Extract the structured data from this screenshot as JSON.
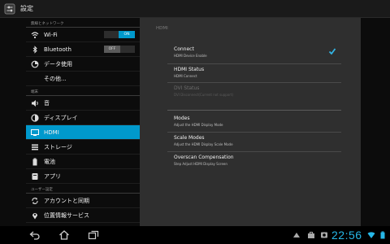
{
  "app": {
    "title": "設定",
    "icon": "settings-icon"
  },
  "sidebar": {
    "sections": [
      {
        "header": "無線とネットワーク",
        "items": [
          {
            "label": "Wi-Fi",
            "icon": "wifi-icon",
            "toggle": "ON"
          },
          {
            "label": "Bluetooth",
            "icon": "bluetooth-icon",
            "toggle": "OFF"
          },
          {
            "label": "データ使用",
            "icon": "data-usage-icon"
          },
          {
            "label": "その他..."
          }
        ]
      },
      {
        "header": "端末",
        "items": [
          {
            "label": "音",
            "icon": "sound-icon"
          },
          {
            "label": "ディスプレイ",
            "icon": "display-icon"
          },
          {
            "label": "HDMI",
            "icon": "hdmi-icon",
            "selected": true
          },
          {
            "label": "ストレージ",
            "icon": "storage-icon"
          },
          {
            "label": "電池",
            "icon": "battery-icon"
          },
          {
            "label": "アプリ",
            "icon": "apps-icon"
          }
        ]
      },
      {
        "header": "ユーザー設定",
        "items": [
          {
            "label": "アカウントと同期",
            "icon": "sync-icon"
          },
          {
            "label": "位置情報サービス",
            "icon": "location-icon"
          }
        ]
      }
    ]
  },
  "detail": {
    "header": "HDMI",
    "items": [
      {
        "title": "Connect",
        "summary": "HDMI Device Enable",
        "checked": true
      },
      {
        "title": "HDMI Status",
        "summary": "HDMI Connect"
      },
      {
        "title": "DVI Status",
        "summary": "DVI Disconnect(Current not support)",
        "disabled": true
      },
      {
        "title": "Modes",
        "summary": "Adjust the HDMI Display Mode"
      },
      {
        "title": "Scale Modes",
        "summary": "Adjust the HDMI Display Scale Mode"
      },
      {
        "title": "Overscan Compensation",
        "summary": "Step Adjust HDMI Display Screen"
      }
    ]
  },
  "statusbar": {
    "time": "22:56"
  },
  "colors": {
    "accent": "#0099cc",
    "clock": "#27b8e8"
  }
}
